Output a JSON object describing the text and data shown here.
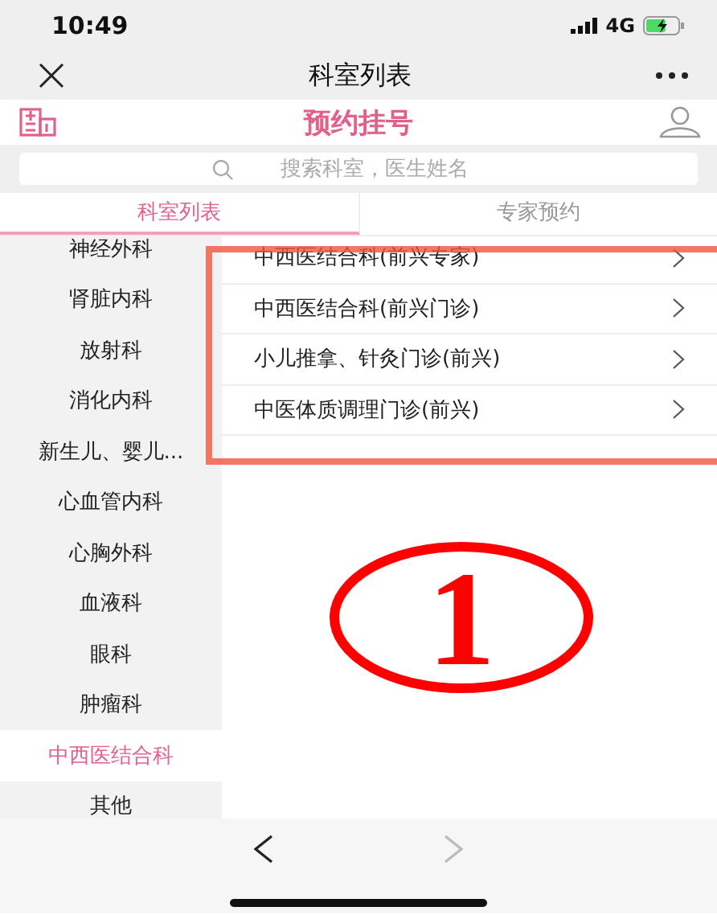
{
  "status_bar": {
    "time": "10:49",
    "network": "4G"
  },
  "nav_bar": {
    "title": "科室列表"
  },
  "header": {
    "title": "预约挂号"
  },
  "search": {
    "placeholder": "搜索科室，医生姓名"
  },
  "tabs": [
    {
      "label": "科室列表",
      "selected": true
    },
    {
      "label": "专家预约",
      "selected": false
    }
  ],
  "departments": [
    {
      "label": "神经外科",
      "selected": false
    },
    {
      "label": "肾脏内科",
      "selected": false
    },
    {
      "label": "放射科",
      "selected": false
    },
    {
      "label": "消化内科",
      "selected": false
    },
    {
      "label": "新生儿、婴儿...",
      "selected": false
    },
    {
      "label": "心血管内科",
      "selected": false
    },
    {
      "label": "心胸外科",
      "selected": false
    },
    {
      "label": "血液科",
      "selected": false
    },
    {
      "label": "眼科",
      "selected": false
    },
    {
      "label": "肿瘤科",
      "selected": false
    },
    {
      "label": "中西医结合科",
      "selected": true
    },
    {
      "label": "其他",
      "selected": false
    }
  ],
  "clinics": [
    {
      "label": "中西医结合科(前兴专家)"
    },
    {
      "label": "中西医结合科(前兴门诊)"
    },
    {
      "label": "小儿推拿、针灸门诊(前兴)"
    },
    {
      "label": "中医体质调理门诊(前兴)"
    }
  ],
  "annotation": {
    "number": "1"
  },
  "toolbar": {
    "back_disabled": false,
    "forward_disabled": true
  }
}
